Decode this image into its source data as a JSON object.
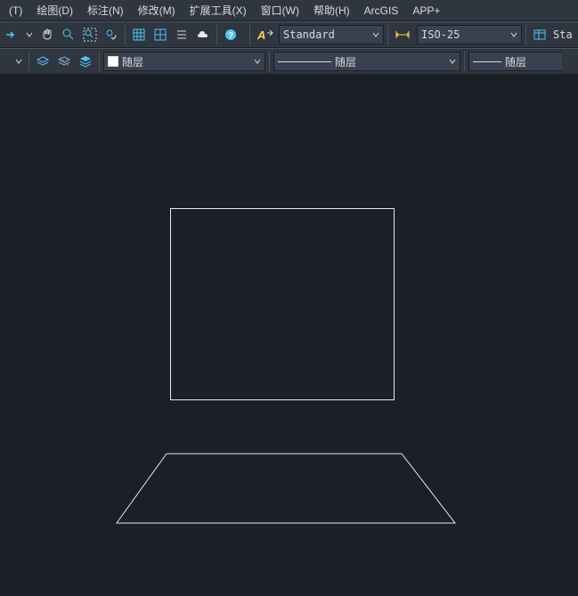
{
  "menu": {
    "items": [
      "(T)",
      "绘图(D)",
      "标注(N)",
      "修改(M)",
      "扩展工具(X)",
      "窗口(W)",
      "帮助(H)",
      "ArcGIS",
      "APP+"
    ]
  },
  "toolbar1": {
    "textstyle": "Standard",
    "dimstyle": "ISO-25",
    "right_label": "Sta"
  },
  "toolbar2": {
    "layer_combo": "随层",
    "linetype_combo": "随层",
    "lineweight_combo": "随层"
  },
  "icons": {
    "arrow_right": "→",
    "pan": "✋",
    "zoom_window": "🔍",
    "zoom_extents": "⤢",
    "zoom_prev": "↶",
    "grid1": "▦",
    "grid2": "▤",
    "list": "≣",
    "cloud": "☁",
    "help": "?",
    "textstyle_icon": "A↗",
    "dimstyle_icon": "⟷",
    "table_icon": "▦",
    "layer1": "≡",
    "layer2": "≣",
    "layer3": "⊞",
    "color_swatch": "■"
  }
}
